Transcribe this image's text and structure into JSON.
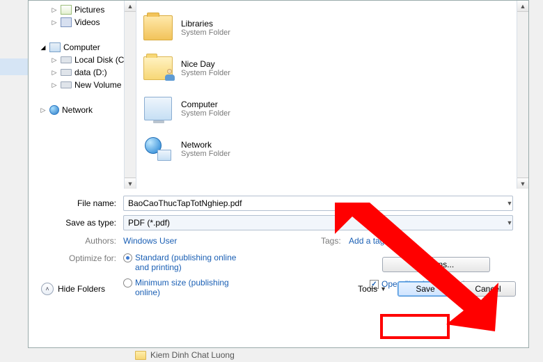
{
  "tree": {
    "pictures": "Pictures",
    "videos": "Videos",
    "computer": "Computer",
    "local_c": "Local Disk (C:)",
    "data_d": "data (D:)",
    "new_vol": "New Volume (E",
    "network": "Network"
  },
  "folders": {
    "sub": "System Folder",
    "libraries": "Libraries",
    "niceday": "Nice Day",
    "computer": "Computer",
    "network": "Network"
  },
  "form": {
    "filename_label": "File name:",
    "filename_value": "BaoCaoThucTapTotNghiep.pdf",
    "savetype_label": "Save as type:",
    "savetype_value": "PDF (*.pdf)",
    "authors_label": "Authors:",
    "authors_value": "Windows User",
    "tags_label": "Tags:",
    "tags_value": "Add a tag",
    "optimize_label": "Optimize for:",
    "opt_standard": "Standard (publishing online and printing)",
    "opt_minimum": "Minimum size (publishing online)",
    "options_btn": "Options...",
    "open_after": "Open file after publishing"
  },
  "bottom": {
    "hide_folders": "Hide Folders",
    "tools": "Tools",
    "save": "Save",
    "cancel": "Cancel"
  },
  "behind": {
    "bottom_text": "Kiem Dinh Chat Luong"
  }
}
